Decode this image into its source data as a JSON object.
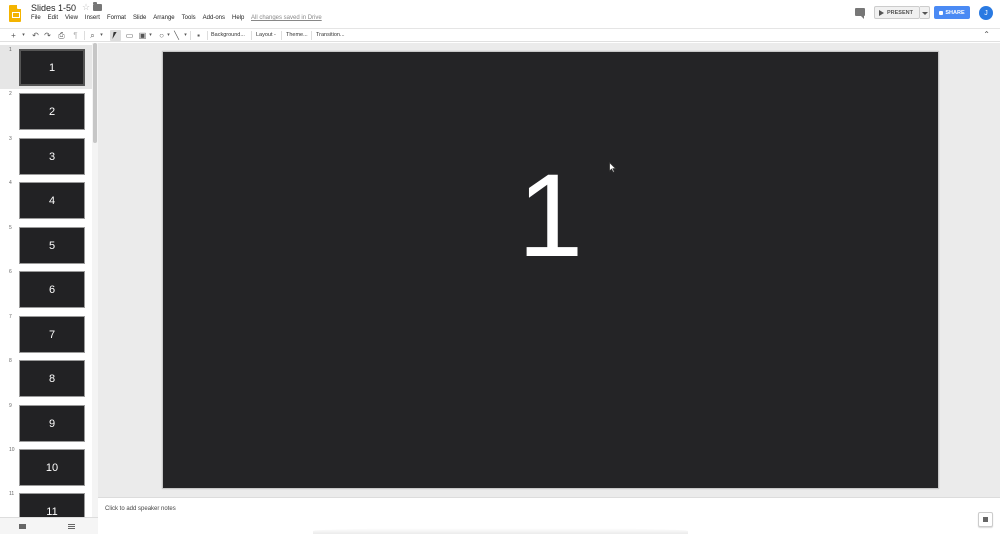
{
  "app": {
    "doc_title": "Slides 1-50",
    "menus": [
      "File",
      "Edit",
      "View",
      "Insert",
      "Format",
      "Slide",
      "Arrange",
      "Tools",
      "Add-ons",
      "Help"
    ],
    "saved_status": "All changes saved in Drive",
    "present_label": "PRESENT",
    "share_label": "SHARE",
    "avatar_initial": "J"
  },
  "toolbar": {
    "background_label": "Background...",
    "layout_label": "Layout -",
    "theme_label": "Theme...",
    "transition_label": "Transition..."
  },
  "filmstrip": {
    "slides": [
      {
        "index": "1",
        "label": "1"
      },
      {
        "index": "2",
        "label": "2"
      },
      {
        "index": "3",
        "label": "3"
      },
      {
        "index": "4",
        "label": "4"
      },
      {
        "index": "5",
        "label": "5"
      },
      {
        "index": "6",
        "label": "6"
      },
      {
        "index": "7",
        "label": "7"
      },
      {
        "index": "8",
        "label": "8"
      },
      {
        "index": "9",
        "label": "9"
      },
      {
        "index": "10",
        "label": "10"
      },
      {
        "index": "11",
        "label": "11"
      }
    ]
  },
  "canvas": {
    "slide_text": "1"
  },
  "notes": {
    "placeholder": "Click to add speaker notes"
  },
  "colors": {
    "slide_bg": "#242426",
    "accent": "#4a8af4",
    "logo": "#f4b400"
  }
}
